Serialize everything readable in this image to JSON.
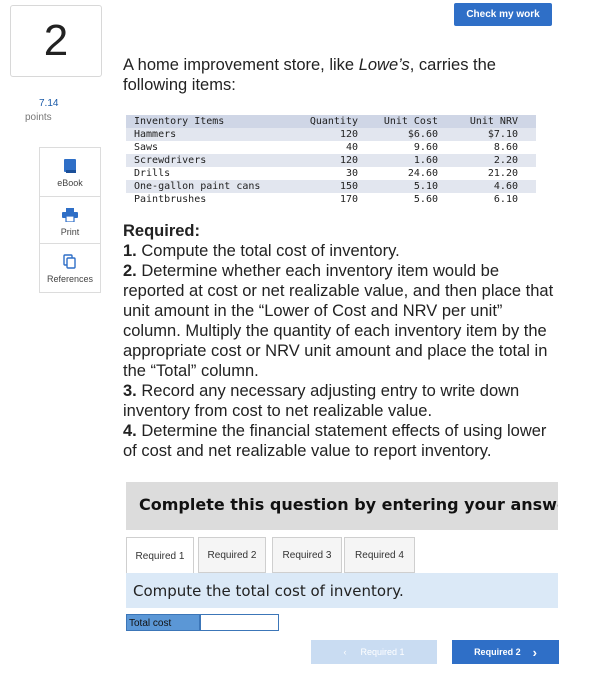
{
  "question": {
    "number": "2",
    "points_value": "7.14",
    "points_label": "points"
  },
  "toolbar": {
    "check_label": "Check my work"
  },
  "sidebar": {
    "items": [
      {
        "label": "eBook",
        "icon": "book-icon"
      },
      {
        "label": "Print",
        "icon": "printer-icon"
      },
      {
        "label": "References",
        "icon": "copy-icon"
      }
    ]
  },
  "intro": {
    "pre": "A home improvement store, like ",
    "brand": "Lowe’s",
    "post": ", carries the following items:"
  },
  "inventory": {
    "headers": [
      "Inventory Items",
      "Quantity",
      "Unit Cost",
      "Unit NRV"
    ],
    "rows": [
      [
        "Hammers",
        "120",
        "$6.60",
        "$7.10"
      ],
      [
        "Saws",
        "40",
        "9.60",
        "8.60"
      ],
      [
        "Screwdrivers",
        "120",
        "1.60",
        "2.20"
      ],
      [
        "Drills",
        "30",
        "24.60",
        "21.20"
      ],
      [
        "One-gallon paint cans",
        "150",
        "5.10",
        "4.60"
      ],
      [
        "Paintbrushes",
        "170",
        "5.60",
        "6.10"
      ]
    ]
  },
  "required": {
    "heading": "Required:",
    "items": [
      {
        "num": "1.",
        "text": " Compute the total cost of inventory."
      },
      {
        "num": "2.",
        "text": " Determine whether each inventory item would be reported at cost or net realizable value, and then place that unit amount in the “Lower of Cost and NRV per unit” column. Multiply the quantity of each inventory item by the appropriate cost or NRV unit amount and place the total in the “Total” column."
      },
      {
        "num": "3.",
        "text": " Record any necessary adjusting entry to write down inventory from cost to net realizable value."
      },
      {
        "num": "4.",
        "text": " Determine the financial statement effects of using lower of cost and net realizable value to report inventory."
      }
    ]
  },
  "banner": {
    "text": "Complete this question by entering your answers in the tabs below."
  },
  "tabs": [
    "Required 1",
    "Required 2",
    "Required 3",
    "Required 4"
  ],
  "active_tab": "Required 1",
  "panel": {
    "instruction": "Compute the total cost of inventory.",
    "field_label": "Total cost",
    "field_value": ""
  },
  "nav": {
    "prev_label": "Required 1",
    "next_label": "Required 2"
  },
  "colors": {
    "accent": "#2f6fc7",
    "disabled": "#c9dcf2",
    "panel": "#dbe9f7"
  }
}
